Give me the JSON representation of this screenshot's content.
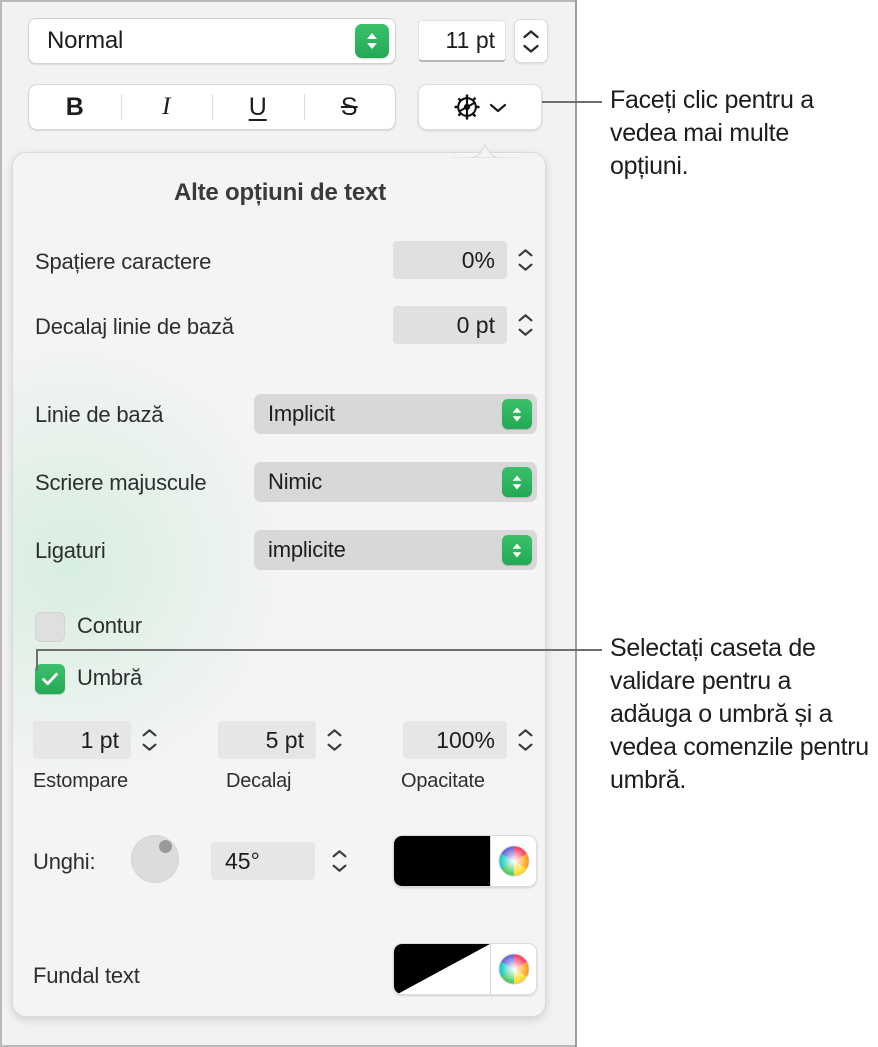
{
  "toolbar": {
    "paragraph_style": {
      "value": "Normal",
      "icon": "up-down-stepper-icon"
    },
    "font_size": {
      "value": "11 pt"
    },
    "format_buttons": [
      {
        "name": "bold",
        "label": "B"
      },
      {
        "name": "italic",
        "label": "I"
      },
      {
        "name": "underline",
        "label": "U"
      },
      {
        "name": "strikethrough",
        "label": "S"
      }
    ],
    "more_options_button": {
      "icon": "gear-icon",
      "chevron": "chevron-down-icon"
    }
  },
  "popover": {
    "title": "Alte opțiuni de text",
    "character_spacing": {
      "label": "Spațiere caractere",
      "value": "0%"
    },
    "baseline_shift": {
      "label": "Decalaj linie de bază",
      "value": "0 pt"
    },
    "baseline": {
      "label": "Linie de bază",
      "value": "Implicit"
    },
    "capitalization": {
      "label": "Scriere majuscule",
      "value": "Nimic"
    },
    "ligatures": {
      "label": "Ligaturi",
      "value": "implicite"
    },
    "outline": {
      "label": "Contur",
      "checked": false
    },
    "shadow": {
      "label": "Umbră",
      "checked": true
    },
    "shadow_controls": {
      "blur": {
        "value": "1 pt",
        "label": "Estompare"
      },
      "offset": {
        "value": "5 pt",
        "label": "Decalaj"
      },
      "opacity": {
        "value": "100%",
        "label": "Opacitate"
      },
      "angle": {
        "label": "Unghi:",
        "value": "45°",
        "dial": "angle-dial-icon"
      },
      "color": {
        "swatch": "#000000",
        "wheel": "color-wheel-icon"
      }
    },
    "text_background": {
      "label": "Fundal text",
      "swatch_type": "diagonal-none",
      "swatch": "#000000",
      "wheel": "color-wheel-icon"
    }
  },
  "callouts": [
    {
      "name": "more-options",
      "text": "Faceți clic pentru a vedea mai multe opțiuni."
    },
    {
      "name": "shadow-checkbox",
      "text": "Selectați caseta de validare pentru a adăuga o umbră și a vedea comenzile pentru umbră."
    }
  ],
  "colors": {
    "accent_green": "#29a85a",
    "panel_bg": "#f4f4f4",
    "app_bg": "#f2f2f2",
    "leader_line": "#6f6f6f"
  }
}
